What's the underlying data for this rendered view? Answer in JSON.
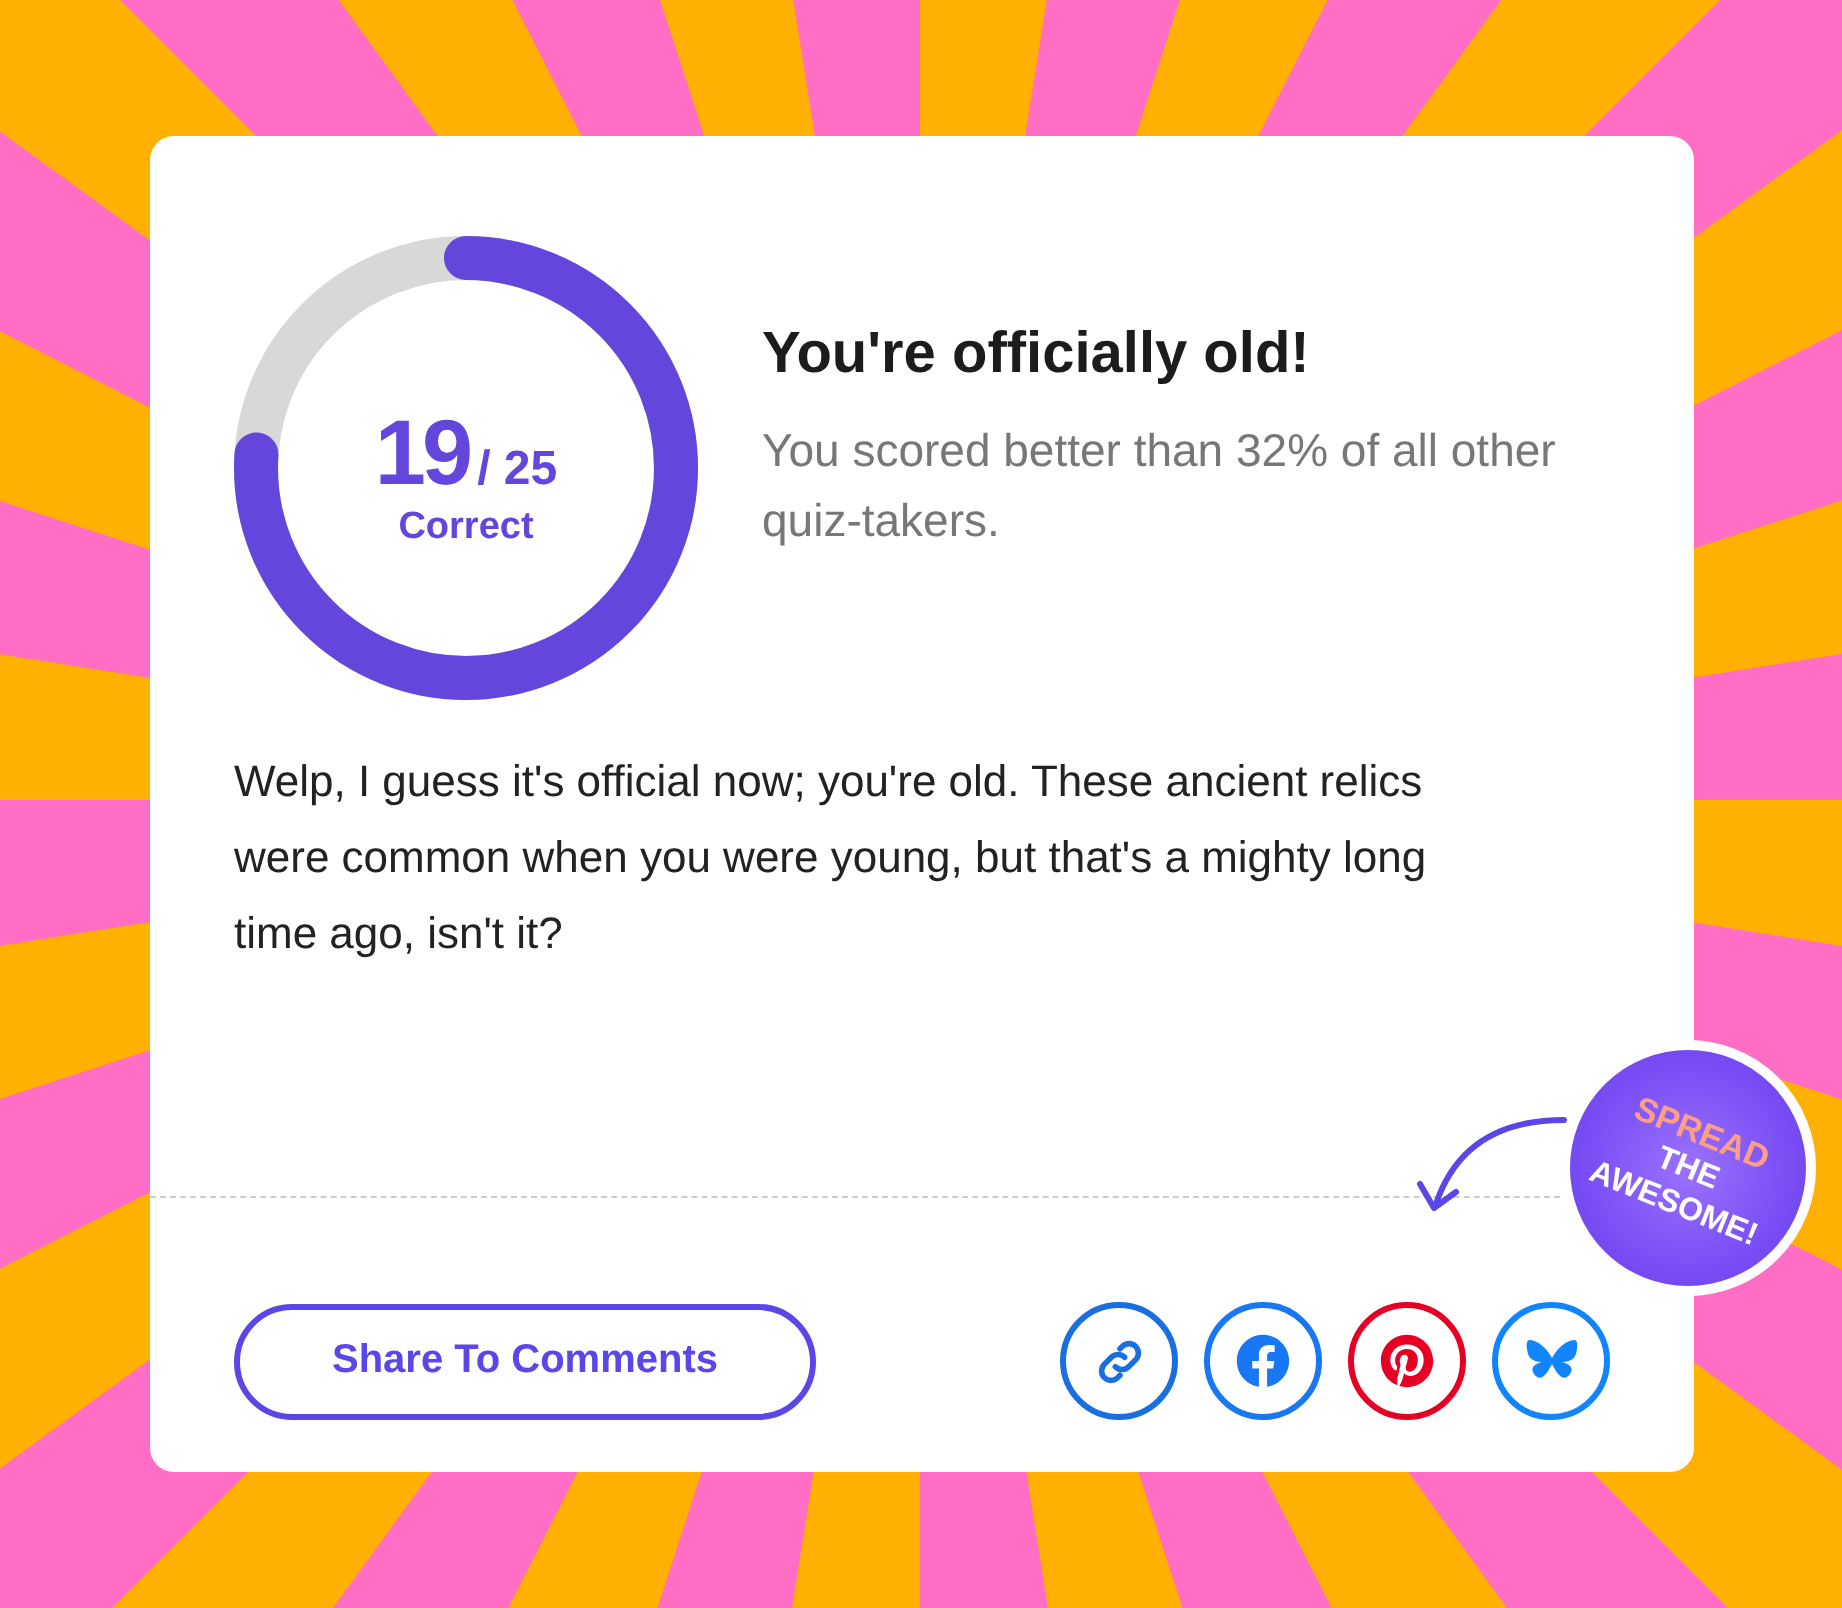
{
  "score": {
    "value": "19",
    "total": "/ 25",
    "label": "Correct",
    "level": 0.76
  },
  "result": {
    "title": "You're officially old!",
    "subtitle": "You scored better than 32% of all other quiz-takers."
  },
  "description": "Welp, I guess it's official now; you're old. These ancient relics were common when you were young, but that's a mighty long time ago, isn't it?",
  "badge": {
    "lines": [
      "SPREAD",
      "THE",
      "AWESOME!"
    ]
  },
  "share_button": {
    "label": "Share To Comments"
  },
  "share_icons": [
    {
      "kind": "link",
      "color": "#1a6fe0"
    },
    {
      "kind": "facebook",
      "color": "#1877f2"
    },
    {
      "kind": "pinterest",
      "color": "#e60023"
    },
    {
      "kind": "bluesky",
      "color": "#1185fe"
    }
  ]
}
